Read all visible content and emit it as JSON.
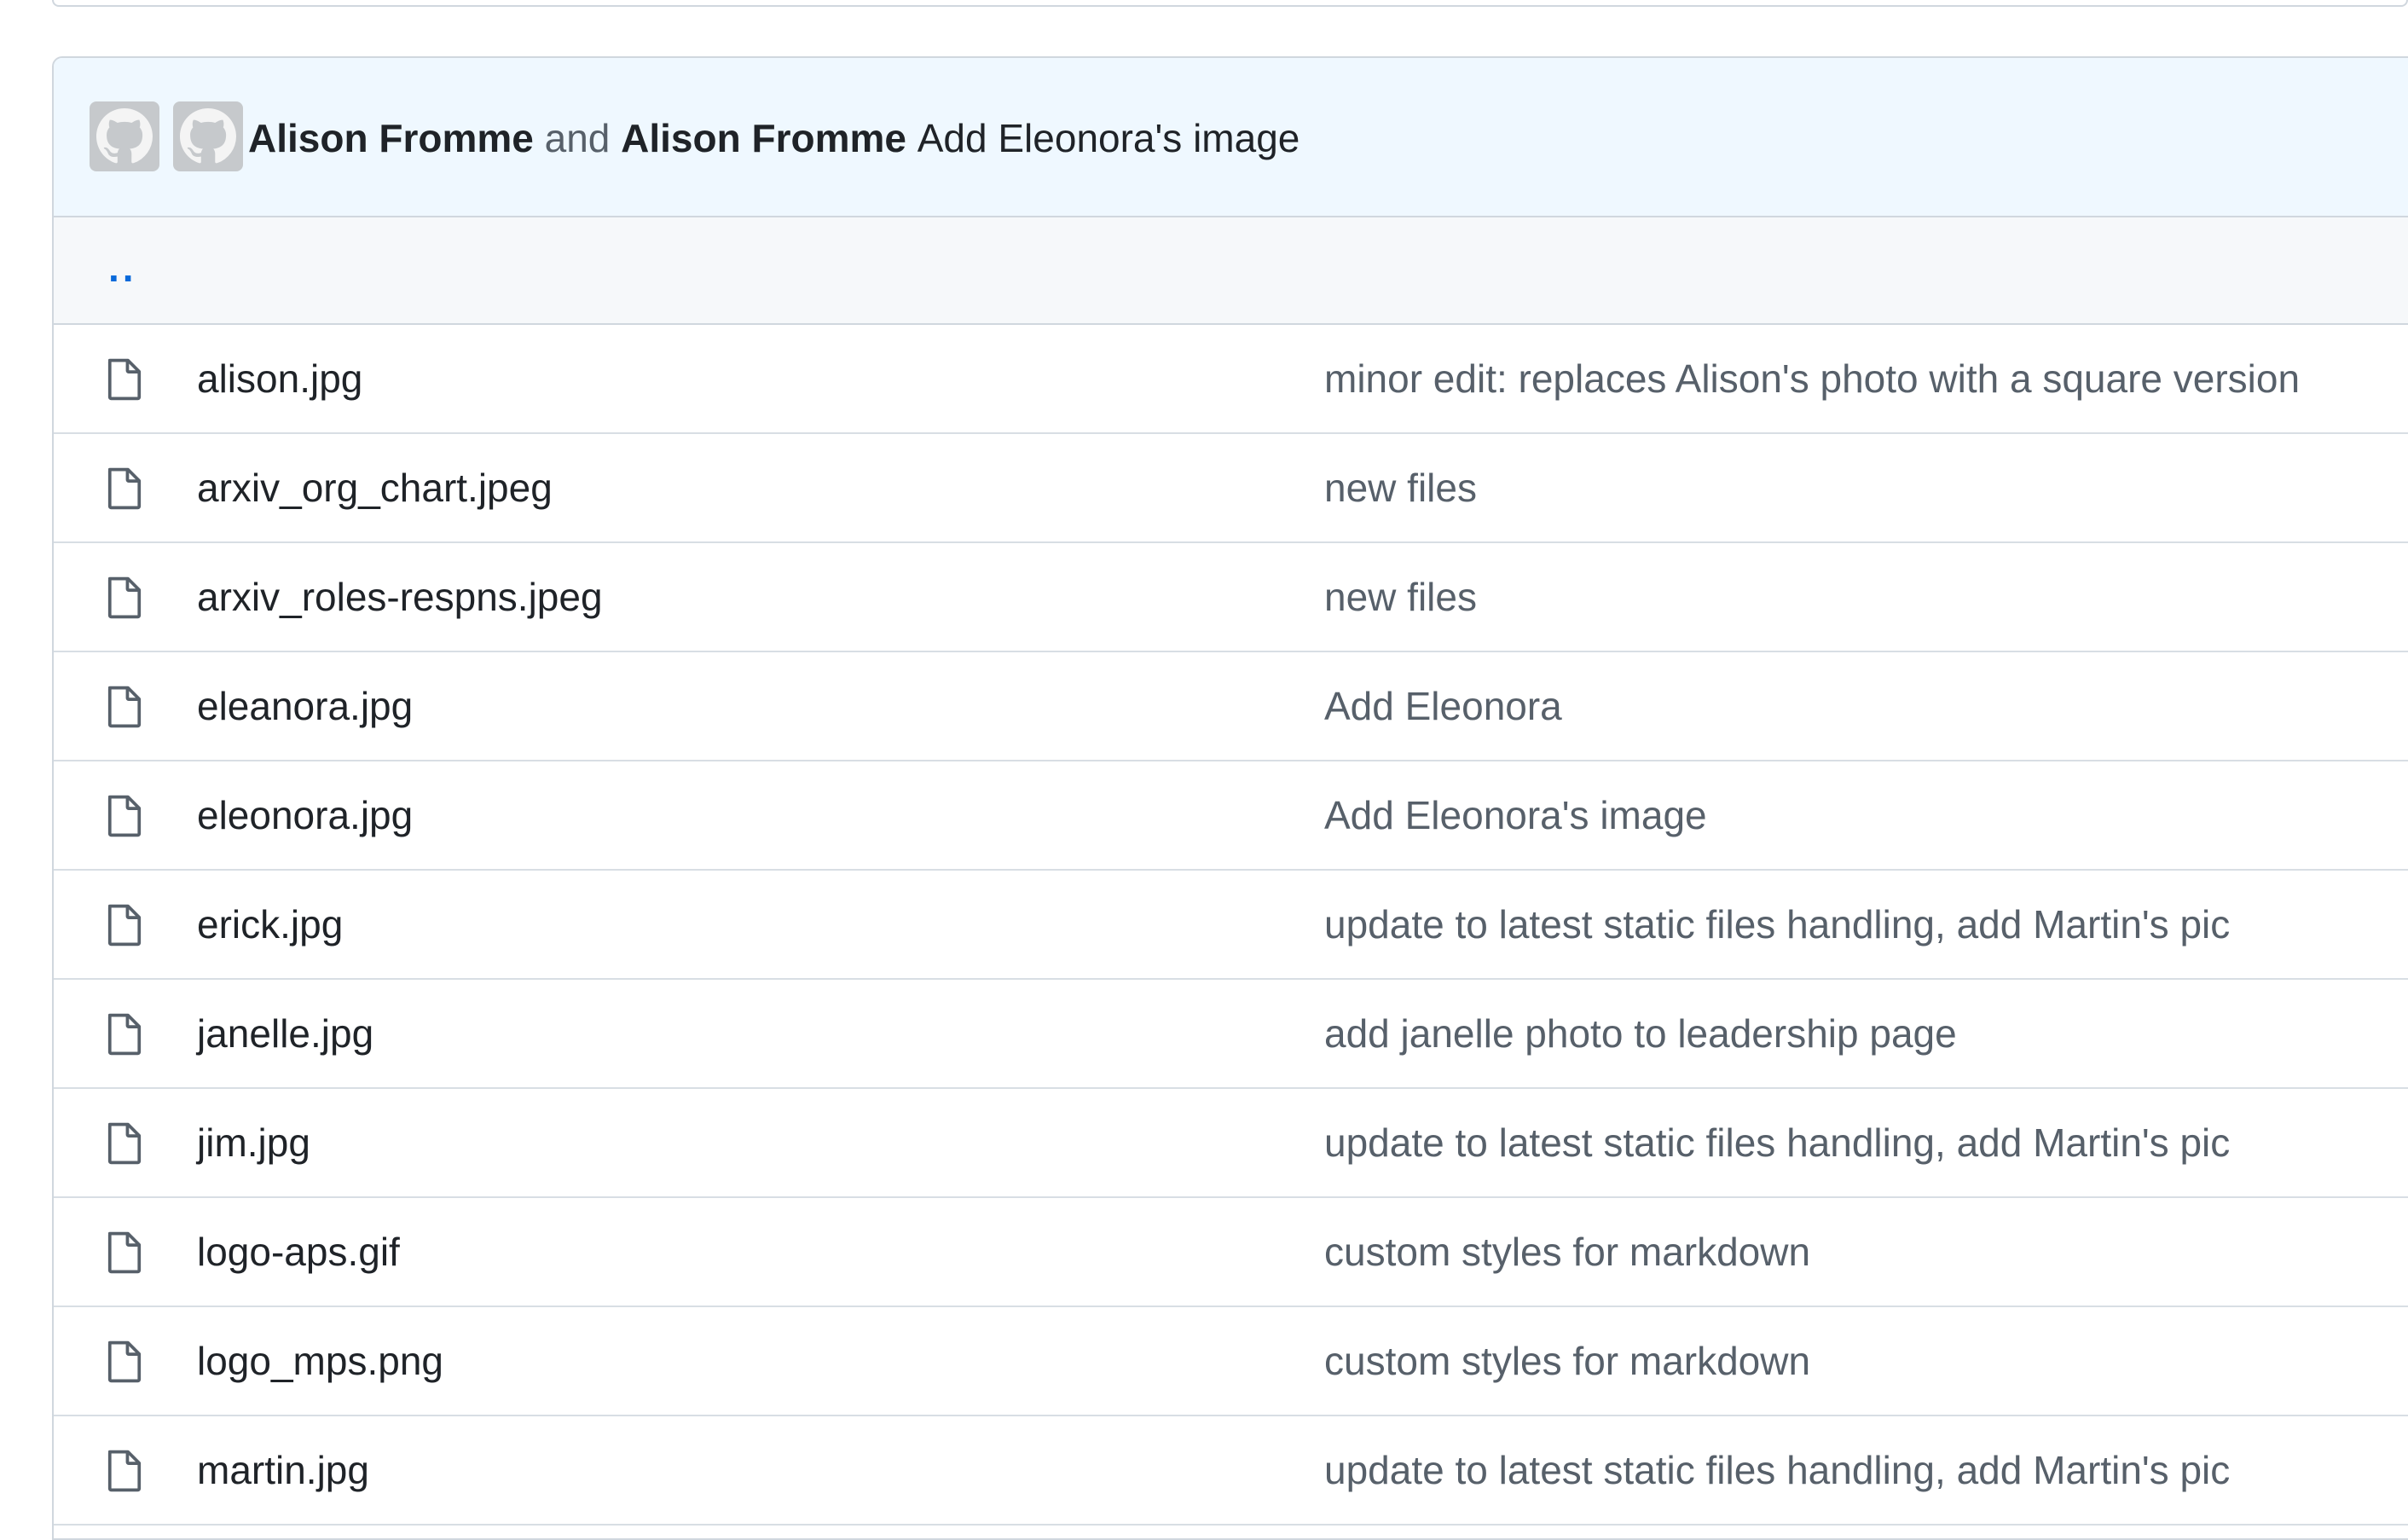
{
  "commit": {
    "author1": "Alison Fromme",
    "joiner": "and",
    "author2": "Alison Fromme",
    "message": "Add Eleonora's image"
  },
  "parent_link": "..",
  "icons": {
    "avatar": "github-octocat-icon",
    "file": "file-icon"
  },
  "colors": {
    "header_bg": "#eff8ff",
    "link": "#0969da",
    "border": "#d0d7de",
    "muted_text": "#57606a"
  },
  "files": [
    {
      "name": "alison.jpg",
      "message": "minor edit: replaces Alison's photo with a square version"
    },
    {
      "name": "arxiv_org_chart.jpeg",
      "message": "new files"
    },
    {
      "name": "arxiv_roles-respns.jpeg",
      "message": "new files"
    },
    {
      "name": "eleanora.jpg",
      "message": "Add Eleonora"
    },
    {
      "name": "eleonora.jpg",
      "message": "Add Eleonora's image"
    },
    {
      "name": "erick.jpg",
      "message": "update to latest static files handling, add Martin's pic"
    },
    {
      "name": "janelle.jpg",
      "message": "add janelle photo to leadership page"
    },
    {
      "name": "jim.jpg",
      "message": "update to latest static files handling, add Martin's pic"
    },
    {
      "name": "logo-aps.gif",
      "message": "custom styles for markdown"
    },
    {
      "name": "logo_mps.png",
      "message": "custom styles for markdown"
    },
    {
      "name": "martin.jpg",
      "message": "update to latest static files handling, add Martin's pic"
    }
  ]
}
